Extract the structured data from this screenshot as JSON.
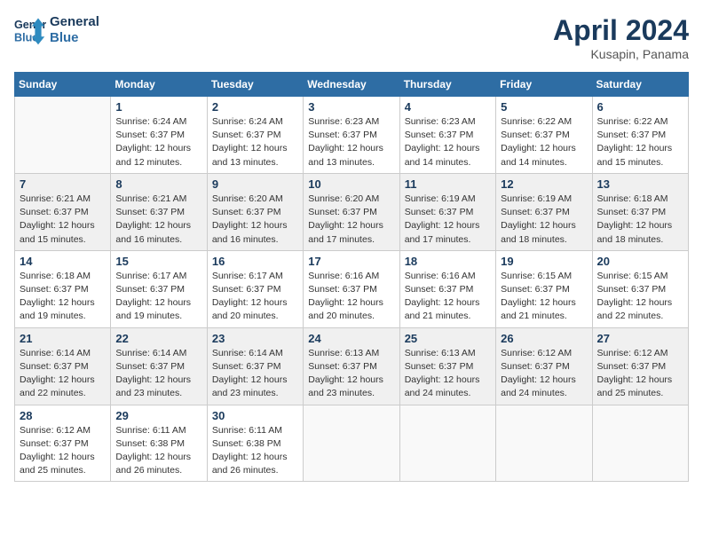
{
  "header": {
    "logo_line1": "General",
    "logo_line2": "Blue",
    "month": "April 2024",
    "location": "Kusapin, Panama"
  },
  "days_of_week": [
    "Sunday",
    "Monday",
    "Tuesday",
    "Wednesday",
    "Thursday",
    "Friday",
    "Saturday"
  ],
  "weeks": [
    [
      {
        "day": "",
        "info": ""
      },
      {
        "day": "1",
        "info": "Sunrise: 6:24 AM\nSunset: 6:37 PM\nDaylight: 12 hours\nand 12 minutes."
      },
      {
        "day": "2",
        "info": "Sunrise: 6:24 AM\nSunset: 6:37 PM\nDaylight: 12 hours\nand 13 minutes."
      },
      {
        "day": "3",
        "info": "Sunrise: 6:23 AM\nSunset: 6:37 PM\nDaylight: 12 hours\nand 13 minutes."
      },
      {
        "day": "4",
        "info": "Sunrise: 6:23 AM\nSunset: 6:37 PM\nDaylight: 12 hours\nand 14 minutes."
      },
      {
        "day": "5",
        "info": "Sunrise: 6:22 AM\nSunset: 6:37 PM\nDaylight: 12 hours\nand 14 minutes."
      },
      {
        "day": "6",
        "info": "Sunrise: 6:22 AM\nSunset: 6:37 PM\nDaylight: 12 hours\nand 15 minutes."
      }
    ],
    [
      {
        "day": "7",
        "info": "Sunrise: 6:21 AM\nSunset: 6:37 PM\nDaylight: 12 hours\nand 15 minutes."
      },
      {
        "day": "8",
        "info": "Sunrise: 6:21 AM\nSunset: 6:37 PM\nDaylight: 12 hours\nand 16 minutes."
      },
      {
        "day": "9",
        "info": "Sunrise: 6:20 AM\nSunset: 6:37 PM\nDaylight: 12 hours\nand 16 minutes."
      },
      {
        "day": "10",
        "info": "Sunrise: 6:20 AM\nSunset: 6:37 PM\nDaylight: 12 hours\nand 17 minutes."
      },
      {
        "day": "11",
        "info": "Sunrise: 6:19 AM\nSunset: 6:37 PM\nDaylight: 12 hours\nand 17 minutes."
      },
      {
        "day": "12",
        "info": "Sunrise: 6:19 AM\nSunset: 6:37 PM\nDaylight: 12 hours\nand 18 minutes."
      },
      {
        "day": "13",
        "info": "Sunrise: 6:18 AM\nSunset: 6:37 PM\nDaylight: 12 hours\nand 18 minutes."
      }
    ],
    [
      {
        "day": "14",
        "info": "Sunrise: 6:18 AM\nSunset: 6:37 PM\nDaylight: 12 hours\nand 19 minutes."
      },
      {
        "day": "15",
        "info": "Sunrise: 6:17 AM\nSunset: 6:37 PM\nDaylight: 12 hours\nand 19 minutes."
      },
      {
        "day": "16",
        "info": "Sunrise: 6:17 AM\nSunset: 6:37 PM\nDaylight: 12 hours\nand 20 minutes."
      },
      {
        "day": "17",
        "info": "Sunrise: 6:16 AM\nSunset: 6:37 PM\nDaylight: 12 hours\nand 20 minutes."
      },
      {
        "day": "18",
        "info": "Sunrise: 6:16 AM\nSunset: 6:37 PM\nDaylight: 12 hours\nand 21 minutes."
      },
      {
        "day": "19",
        "info": "Sunrise: 6:15 AM\nSunset: 6:37 PM\nDaylight: 12 hours\nand 21 minutes."
      },
      {
        "day": "20",
        "info": "Sunrise: 6:15 AM\nSunset: 6:37 PM\nDaylight: 12 hours\nand 22 minutes."
      }
    ],
    [
      {
        "day": "21",
        "info": "Sunrise: 6:14 AM\nSunset: 6:37 PM\nDaylight: 12 hours\nand 22 minutes."
      },
      {
        "day": "22",
        "info": "Sunrise: 6:14 AM\nSunset: 6:37 PM\nDaylight: 12 hours\nand 23 minutes."
      },
      {
        "day": "23",
        "info": "Sunrise: 6:14 AM\nSunset: 6:37 PM\nDaylight: 12 hours\nand 23 minutes."
      },
      {
        "day": "24",
        "info": "Sunrise: 6:13 AM\nSunset: 6:37 PM\nDaylight: 12 hours\nand 23 minutes."
      },
      {
        "day": "25",
        "info": "Sunrise: 6:13 AM\nSunset: 6:37 PM\nDaylight: 12 hours\nand 24 minutes."
      },
      {
        "day": "26",
        "info": "Sunrise: 6:12 AM\nSunset: 6:37 PM\nDaylight: 12 hours\nand 24 minutes."
      },
      {
        "day": "27",
        "info": "Sunrise: 6:12 AM\nSunset: 6:37 PM\nDaylight: 12 hours\nand 25 minutes."
      }
    ],
    [
      {
        "day": "28",
        "info": "Sunrise: 6:12 AM\nSunset: 6:37 PM\nDaylight: 12 hours\nand 25 minutes."
      },
      {
        "day": "29",
        "info": "Sunrise: 6:11 AM\nSunset: 6:38 PM\nDaylight: 12 hours\nand 26 minutes."
      },
      {
        "day": "30",
        "info": "Sunrise: 6:11 AM\nSunset: 6:38 PM\nDaylight: 12 hours\nand 26 minutes."
      },
      {
        "day": "",
        "info": ""
      },
      {
        "day": "",
        "info": ""
      },
      {
        "day": "",
        "info": ""
      },
      {
        "day": "",
        "info": ""
      }
    ]
  ]
}
